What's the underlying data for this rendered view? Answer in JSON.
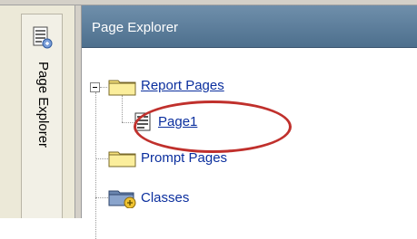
{
  "side_panel": {
    "tab_label": "Page Explorer"
  },
  "panel": {
    "title": "Page Explorer"
  },
  "tree": {
    "report_pages": "Report Pages",
    "page1": "Page1",
    "prompt_pages": "Prompt Pages",
    "classes": "Classes"
  },
  "colors": {
    "header": "#5b7b99",
    "link": "#0b2f9e",
    "highlight_ring": "#c0302c"
  }
}
